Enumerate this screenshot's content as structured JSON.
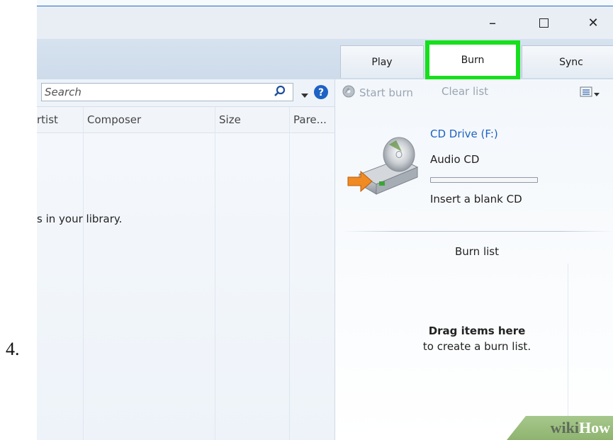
{
  "step_number": "4.",
  "window": {
    "controls": {
      "minimize_glyph": "–",
      "maximize_glyph": "□",
      "close_glyph": "✕"
    }
  },
  "tabs": [
    {
      "label": "Play",
      "active": false
    },
    {
      "label": "Burn",
      "active": true
    },
    {
      "label": "Sync",
      "active": false
    }
  ],
  "highlight_color": "#16e01c",
  "library": {
    "search_placeholder": "Search",
    "columns": [
      "rtist",
      "Composer",
      "Size",
      "Pare..."
    ],
    "empty_message": "s in your library."
  },
  "burn_toolbar": {
    "start_burn": "Start burn",
    "clear_list": "Clear list"
  },
  "drive": {
    "name": "CD Drive (F:)",
    "disc_type": "Audio CD",
    "status": "Insert a blank CD",
    "progress": 0
  },
  "burn_list": {
    "title": "Burn list",
    "drag_title": "Drag items here",
    "drag_sub": "to create a burn list."
  },
  "watermark": {
    "part1": "wiki",
    "part2": "How"
  }
}
